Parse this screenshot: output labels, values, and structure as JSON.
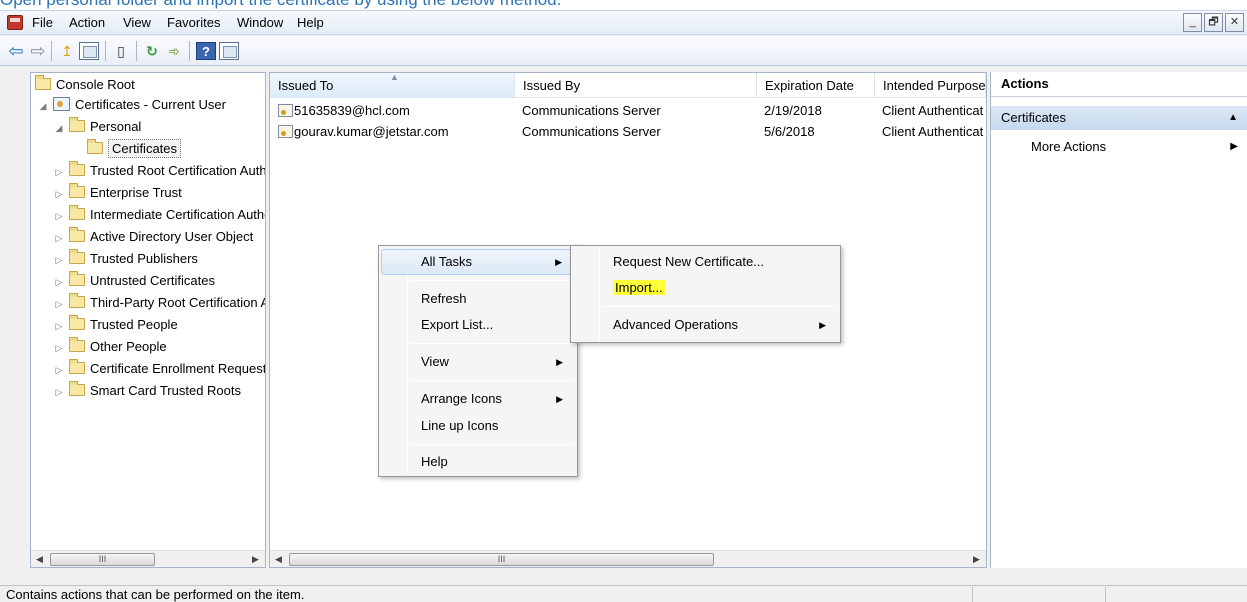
{
  "caption": "Open personal folder and import the certificate by using the below method.",
  "menubar": {
    "items": [
      "File",
      "Action",
      "View",
      "Favorites",
      "Window",
      "Help"
    ],
    "window_buttons": [
      "_",
      "🗗",
      "✕"
    ]
  },
  "toolbar": {
    "icons": [
      "back-arrow-icon",
      "forward-arrow-icon",
      "up-folder-icon",
      "show-hide-tree-icon",
      "clipboard-icon",
      "refresh-icon",
      "export-list-icon",
      "help-icon",
      "show-hide-action-pane-icon"
    ]
  },
  "tree": {
    "root": "Console Root",
    "store": "Certificates - Current User",
    "personal": "Personal",
    "certificates": "Certificates",
    "folders": [
      "Trusted Root Certification Authorities",
      "Enterprise Trust",
      "Intermediate Certification Authorities",
      "Active Directory User Object",
      "Trusted Publishers",
      "Untrusted Certificates",
      "Third-Party Root Certification Authorities",
      "Trusted People",
      "Other People",
      "Certificate Enrollment Requests",
      "Smart Card Trusted Roots"
    ],
    "scrollbar_thumb": "III"
  },
  "list": {
    "columns": [
      "Issued To",
      "Issued By",
      "Expiration Date",
      "Intended Purposes"
    ],
    "rows": [
      {
        "issued_to": "51635839@hcl.com",
        "issued_by": "Communications Server",
        "expiration": "2/19/2018",
        "purpose": "Client Authentication"
      },
      {
        "issued_to": "gourav.kumar@jetstar.com",
        "issued_by": "Communications Server",
        "expiration": "5/6/2018",
        "purpose": "Client Authentication"
      }
    ],
    "scrollbar_thumb": "III"
  },
  "actions": {
    "header": "Actions",
    "group": "Certificates",
    "item": "More Actions"
  },
  "context_menu": {
    "items": [
      "All Tasks",
      "Refresh",
      "Export List...",
      "View",
      "Arrange Icons",
      "Line up Icons",
      "Help"
    ]
  },
  "submenu": {
    "items": [
      "Request New Certificate...",
      "Import...",
      "Advanced Operations"
    ],
    "highlight_color": "#ffff3a"
  },
  "status": {
    "text": "Contains actions that can be performed on the item."
  }
}
